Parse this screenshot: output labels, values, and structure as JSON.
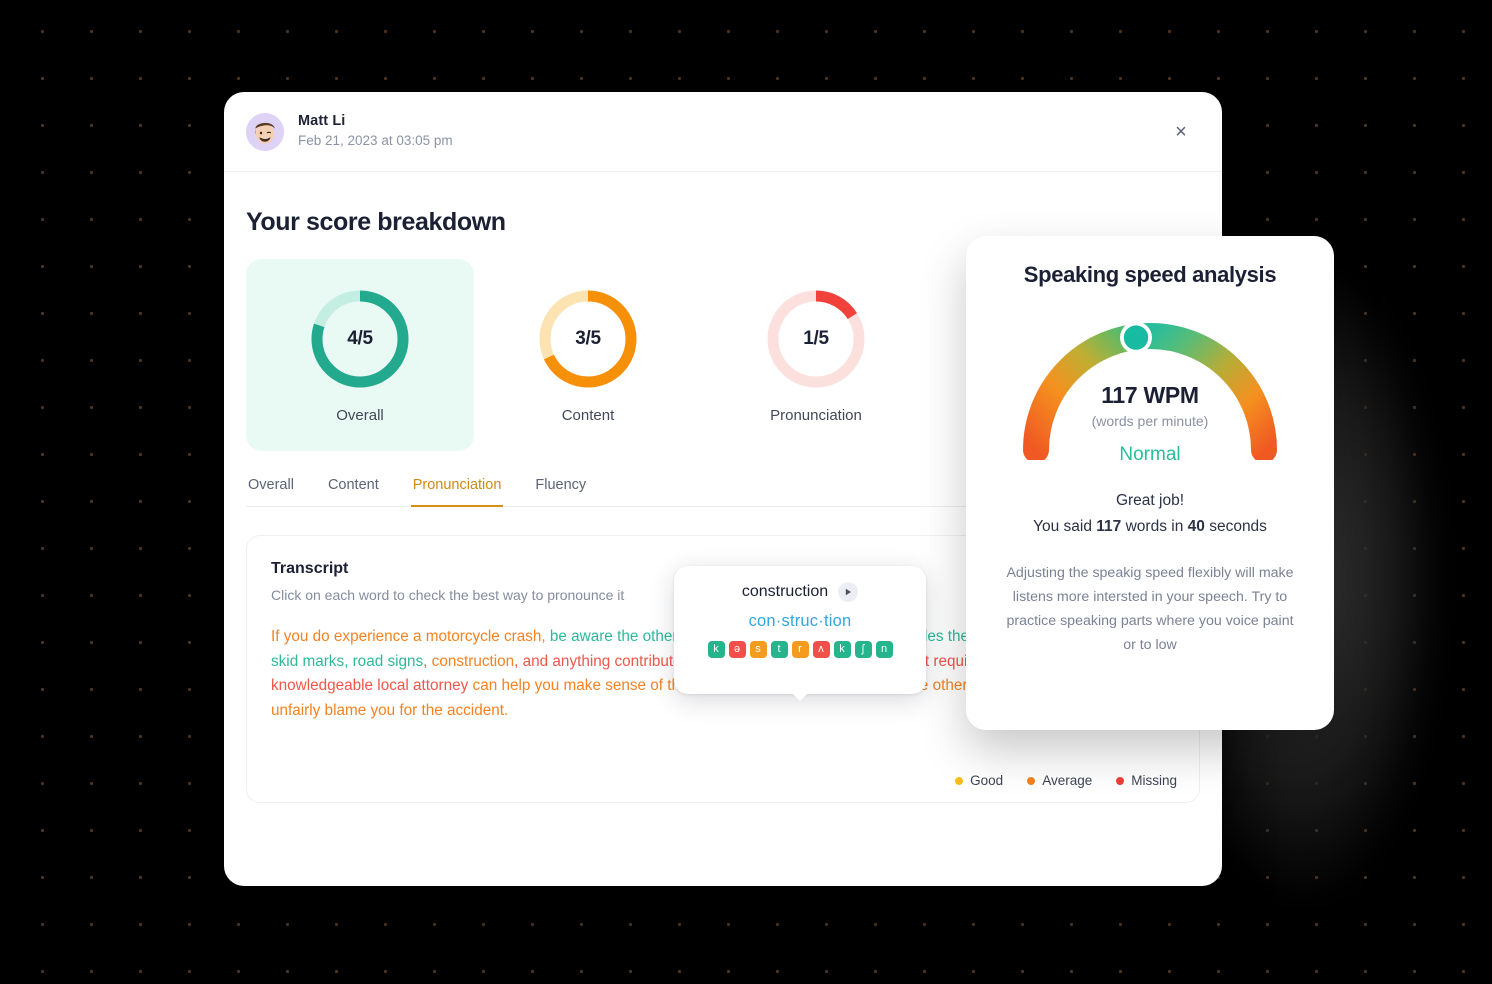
{
  "header": {
    "user_name": "Matt Li",
    "timestamp": "Feb 21, 2023 at 03:05 pm",
    "close_label": "×",
    "avatar_icon": "memoji-avatar"
  },
  "main": {
    "page_title": "Your score breakdown",
    "scores": [
      {
        "value": "4/5",
        "label": "Overall",
        "pct": 80,
        "color": "#23a98e",
        "track": "#c5eee3",
        "active": true
      },
      {
        "value": "3/5",
        "label": "Content",
        "pct": 68,
        "color": "#f79009",
        "track": "#fde3b1",
        "active": false
      },
      {
        "value": "1/5",
        "label": "Pronunciation",
        "pct": 16,
        "color": "#f0413a",
        "track": "#fbe0de",
        "active": false
      }
    ],
    "tabs": [
      {
        "label": "Overall",
        "selected": false
      },
      {
        "label": "Content",
        "selected": false
      },
      {
        "label": "Pronunciation",
        "selected": true
      },
      {
        "label": "Fluency",
        "selected": false
      }
    ],
    "transcript": {
      "title": "Transcript",
      "subtitle": "Click on each word to check the best way to pronounce it",
      "segments": [
        {
          "text": "If you do experience a motorcycle crash, ",
          "grade": "avg"
        },
        {
          "text": "be aware the other driver ir   most likely blame you ",
          "grade": "ok"
        },
        {
          "text": "includes the road, road contruction, any skid marks, road signs",
          "grade": "ok"
        },
        {
          "text": ", ",
          "grade": "miss"
        },
        {
          "text": "construction",
          "grade": "avg"
        },
        {
          "text": ", and anything contributed to the accident. Not every accident requires an attorney but a knowledgeable local attorney ",
          "grade": "miss"
        },
        {
          "text": "can help you make sense of the process, as well as ensure that the other driver's insurance doesn't unfairly blame you for the accident.",
          "grade": "avg"
        }
      ],
      "legend": [
        {
          "label": "Good",
          "color": "#fbbf18"
        },
        {
          "label": "Average",
          "color": "#f58220"
        },
        {
          "label": "Missing",
          "color": "#ef3f38"
        }
      ]
    }
  },
  "pronunciation_popup": {
    "word": "construction",
    "play_icon": "play-icon",
    "syllables": "con·struc·tion",
    "phonemes": [
      {
        "symbol": "k",
        "color": "#26b48c"
      },
      {
        "symbol": "ə",
        "color": "#f1504a"
      },
      {
        "symbol": "s",
        "color": "#f59b1d"
      },
      {
        "symbol": "t",
        "color": "#26b48c"
      },
      {
        "symbol": "r",
        "color": "#f59b1d"
      },
      {
        "symbol": "ʌ",
        "color": "#f1504a"
      },
      {
        "symbol": "k",
        "color": "#26b48c"
      },
      {
        "symbol": "ʃ",
        "color": "#26b48c"
      },
      {
        "symbol": "n",
        "color": "#26b48c"
      }
    ]
  },
  "speed_panel": {
    "title": "Speaking speed analysis",
    "wpm_value": "117 WPM",
    "wpm_unit": "(words per minute)",
    "status": "Normal",
    "great_line": "Great job!",
    "said_prefix": "You said ",
    "said_words": "117",
    "said_mid": " words in ",
    "said_seconds": "40",
    "said_suffix": " seconds",
    "advice": "Adjusting the speakig speed flexibly will make listens more intersted in your speech. Try to practice speaking parts where you voice paint or to low",
    "gauge": {
      "marker_angle_deg": -7,
      "colors": [
        "#f26322",
        "#f58a1f",
        "#c8a72a",
        "#7eb648",
        "#2bbd9b",
        "#2bbd9b",
        "#7eb648",
        "#c8a72a",
        "#f58a1f",
        "#f26322"
      ]
    }
  },
  "chart_data": {
    "type": "pie",
    "title": "Your score breakdown",
    "categories": [
      "Overall",
      "Content",
      "Pronunciation"
    ],
    "values": [
      4,
      3,
      1
    ],
    "max": 5,
    "gauge": {
      "type": "gauge",
      "value": 117,
      "unit": "WPM",
      "label": "Normal",
      "range": [
        0,
        260
      ]
    }
  }
}
